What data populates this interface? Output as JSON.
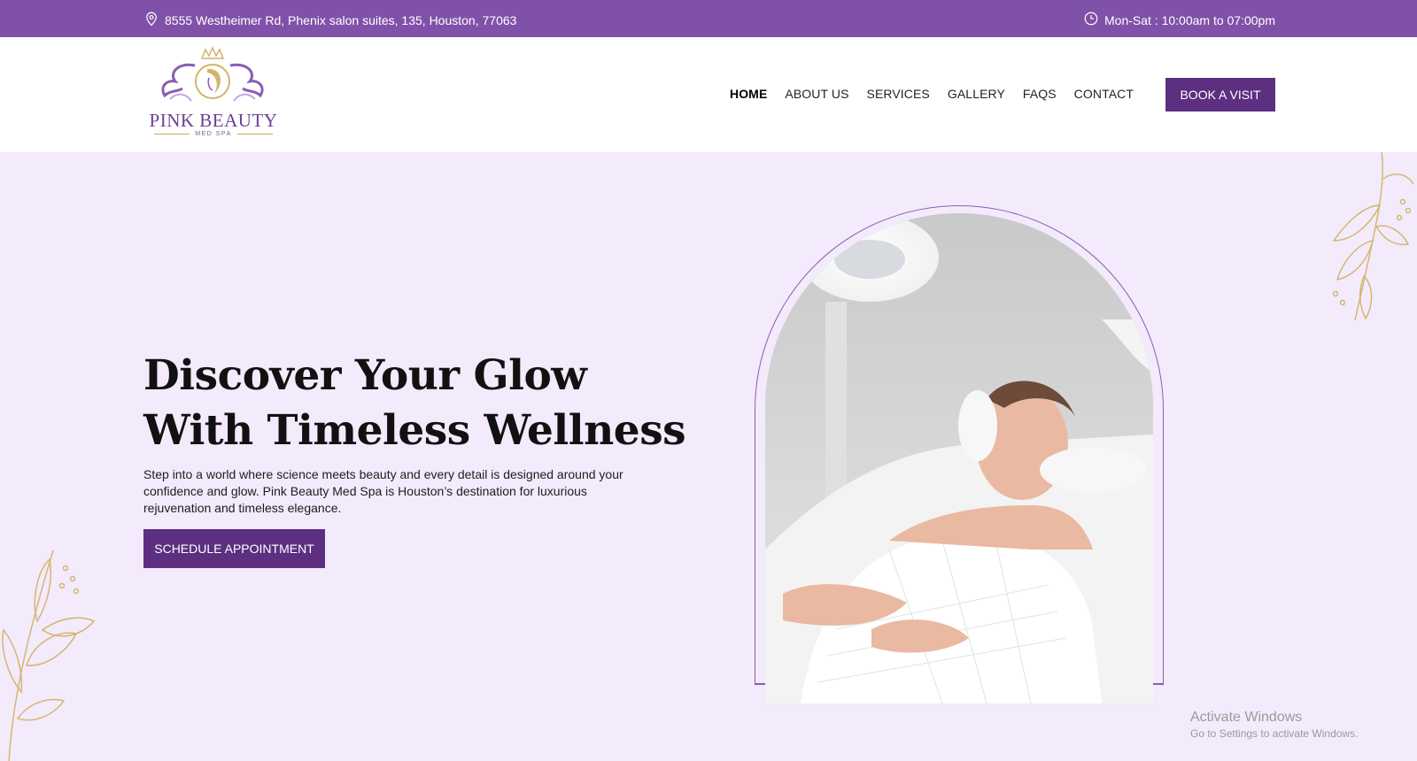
{
  "topbar": {
    "address": "8555 Westheimer Rd, Phenix salon suites, 135, Houston, 77063",
    "hours": "Mon-Sat : 10:00am to 07:00pm",
    "address_icon": "location-pin-icon",
    "hours_icon": "clock-icon"
  },
  "brand": {
    "name": "PINK BEAUTY",
    "tagline": "MED SPA"
  },
  "nav": {
    "items": [
      "HOME",
      "ABOUT US",
      "SERVICES",
      "GALLERY",
      "FAQS",
      "CONTACT"
    ],
    "active": "HOME",
    "cta": "BOOK A VISIT"
  },
  "hero": {
    "title_line1": "Discover Your Glow",
    "title_line2": "With Timeless Wellness",
    "description": "Step into a world where science meets beauty and every detail is designed around your confidence and glow. Pink Beauty Med Spa is Houston’s destination for luxurious rejuvenation and timeless elegance.",
    "cta": "SCHEDULE APPOINTMENT"
  },
  "watermark": {
    "line1": "Activate Windows",
    "line2": "Go to Settings to activate Windows."
  },
  "colors": {
    "topbar": "#8051a8",
    "button": "#5c2f80",
    "hero_bg": "#f3eafb",
    "gold": "#d4b36a"
  }
}
